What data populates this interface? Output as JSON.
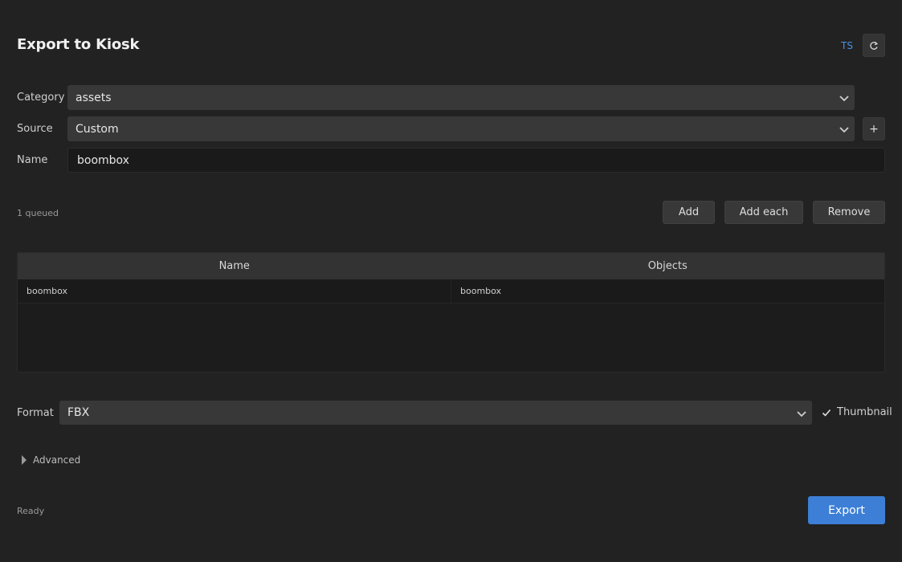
{
  "header": {
    "title": "Export to Kiosk",
    "ts_label": "TS",
    "refresh_icon": "refresh-icon"
  },
  "form": {
    "category": {
      "label": "Category",
      "value": "assets"
    },
    "source": {
      "label": "Source",
      "value": "Custom",
      "add_label": "+"
    },
    "name": {
      "label": "Name",
      "value": "boombox"
    }
  },
  "queue": {
    "count_text": "1 queued",
    "add_label": "Add",
    "add_each_label": "Add each",
    "remove_label": "Remove"
  },
  "table": {
    "columns": [
      "Name",
      "Objects"
    ],
    "rows": [
      {
        "name": "boombox",
        "objects": "boombox"
      }
    ]
  },
  "format": {
    "label": "Format",
    "value": "FBX",
    "thumbnail_label": "Thumbnail",
    "thumbnail_checked": true
  },
  "advanced": {
    "label": "Advanced"
  },
  "footer": {
    "status": "Ready",
    "export_label": "Export"
  },
  "colors": {
    "background": "#222222",
    "accent": "#3d7fd6",
    "link": "#4a90e2"
  }
}
